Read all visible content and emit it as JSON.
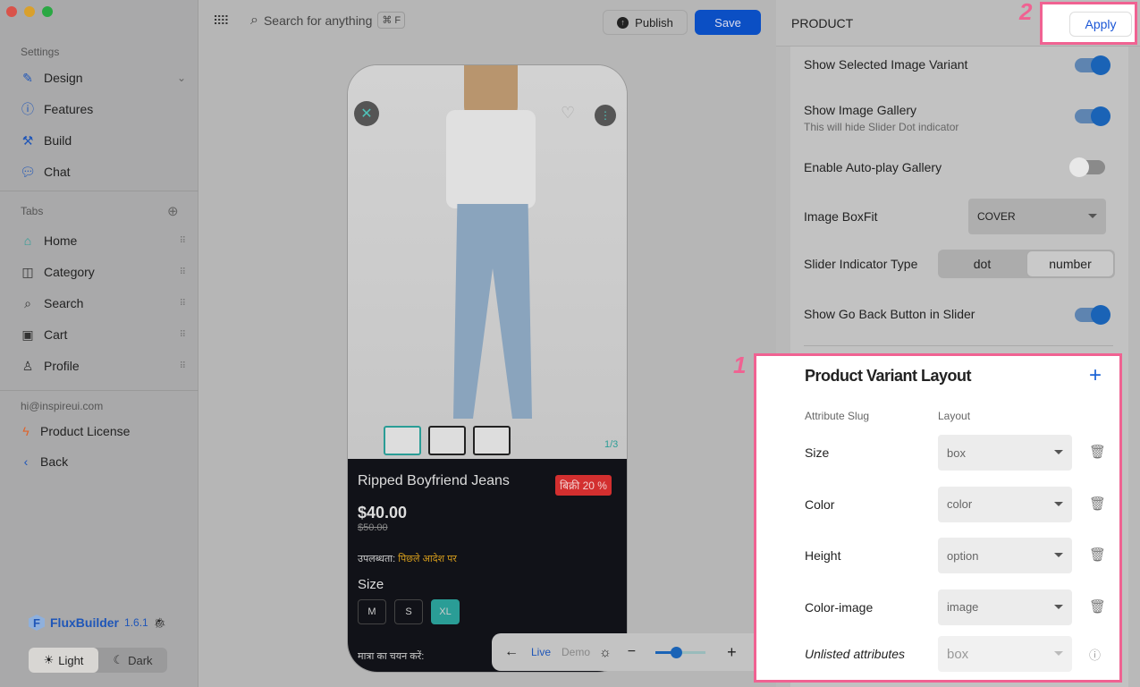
{
  "window": {
    "controls": [
      "close",
      "minimize",
      "maximize"
    ]
  },
  "sidebar": {
    "settings_label": "Settings",
    "settings_items": [
      {
        "label": "Design",
        "icon": "pen-icon"
      },
      {
        "label": "Features",
        "icon": "bolt-icon"
      },
      {
        "label": "Build",
        "icon": "hammer-icon"
      },
      {
        "label": "Chat",
        "icon": "chat-icon"
      }
    ],
    "tabs_label": "Tabs",
    "tabs": [
      {
        "label": "Home",
        "icon": "home-icon"
      },
      {
        "label": "Category",
        "icon": "category-icon"
      },
      {
        "label": "Search",
        "icon": "search-icon"
      },
      {
        "label": "Cart",
        "icon": "cart-icon"
      },
      {
        "label": "Profile",
        "icon": "profile-icon"
      }
    ],
    "email": "hi@inspireui.com",
    "license": "Product License",
    "back": "Back",
    "brand": "FluxBuilder",
    "version": "1.6.1",
    "theme": {
      "light": "Light",
      "dark": "Dark",
      "selected": "Light"
    }
  },
  "topbar": {
    "search_placeholder": "Search for anything",
    "shortcut": "⌘ F",
    "publish": "Publish",
    "save": "Save"
  },
  "phone": {
    "counter": "1/3",
    "title": "Ripped Boyfriend Jeans",
    "sale_badge": "बिक्री 20 %",
    "price": "$40.00",
    "old_price": "$50.00",
    "availability_label": "उपलब्धता:",
    "availability_value": "पिछले आदेश पर",
    "size_label": "Size",
    "sizes": [
      "M",
      "S",
      "XL"
    ],
    "selected_size": "XL",
    "qty_label": "मात्रा का चयन करें:"
  },
  "preview_bar": {
    "live": "Live",
    "demo": "Demo",
    "zoom_level": 0.4
  },
  "panel": {
    "title": "PRODUCT",
    "apply": "Apply",
    "settings": [
      {
        "label": "Show Selected Image Variant",
        "on": true
      },
      {
        "label": "Show Image Gallery",
        "sub": "This will hide Slider Dot indicator",
        "on": true
      },
      {
        "label": "Enable Auto-play Gallery",
        "on": false
      }
    ],
    "boxfit_label": "Image BoxFit",
    "boxfit_value": "COVER",
    "indicator_label": "Slider Indicator Type",
    "indicator_options": [
      "dot",
      "number"
    ],
    "indicator_selected": "number",
    "go_back_label": "Show Go Back Button in Slider",
    "go_back_on": true
  },
  "variant_layout": {
    "title": "Product Variant Layout",
    "col_slug": "Attribute Slug",
    "col_layout": "Layout",
    "rows": [
      {
        "slug": "Size",
        "layout": "box"
      },
      {
        "slug": "Color",
        "layout": "color"
      },
      {
        "slug": "Height",
        "layout": "option"
      },
      {
        "slug": "Color-image",
        "layout": "image"
      }
    ],
    "unlisted_label": "Unlisted attributes",
    "unlisted_value": "box"
  },
  "annotations": {
    "one": "1",
    "two": "2"
  },
  "colors": {
    "accent": "#0b4fc4",
    "highlight": "#f06292",
    "sale": "#d32f2f",
    "selected_size": "#2a9d96"
  }
}
